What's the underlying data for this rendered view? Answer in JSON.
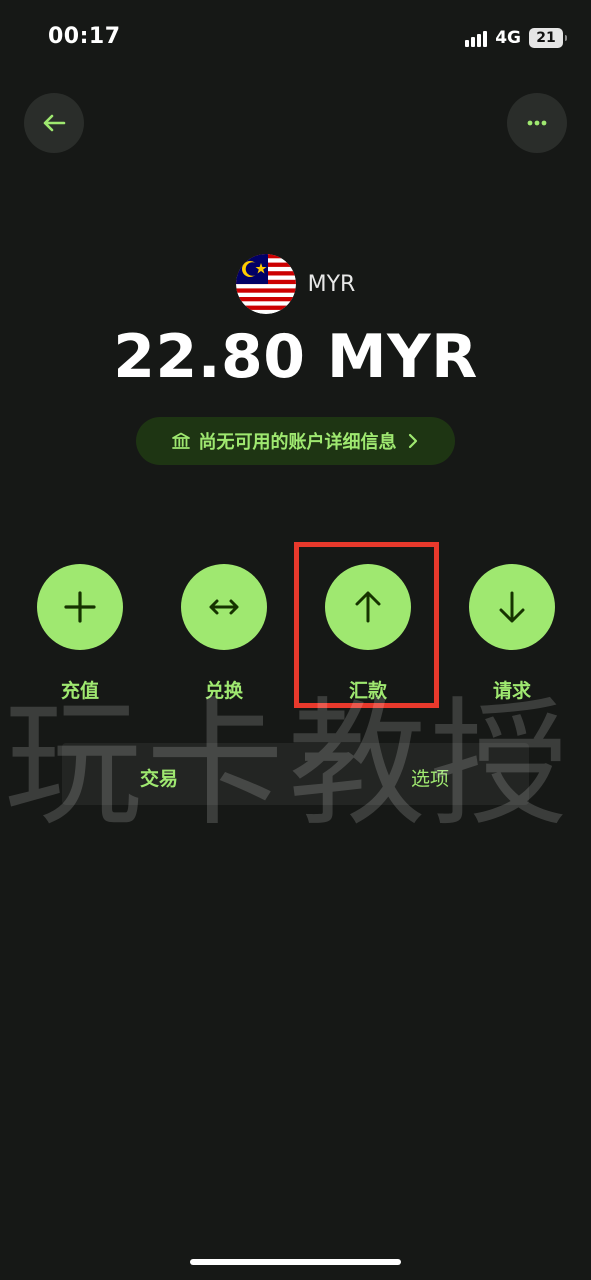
{
  "status_bar": {
    "time": "00:17",
    "network": "4G",
    "battery": "21"
  },
  "header": {
    "back_icon": "arrow-left-icon",
    "more_icon": "ellipsis-icon"
  },
  "account": {
    "currency_code": "MYR",
    "flag_icon": "malaysia-flag-icon",
    "balance": "22.80 MYR",
    "details_text": "尚无可用的账户详细信息"
  },
  "actions": [
    {
      "label": "充值",
      "icon": "plus-icon"
    },
    {
      "label": "兑换",
      "icon": "swap-arrows-icon"
    },
    {
      "label": "汇款",
      "icon": "arrow-up-icon"
    },
    {
      "label": "请求",
      "icon": "arrow-down-icon"
    }
  ],
  "tabs": {
    "transactions": "交易",
    "options": "选项"
  },
  "watermark": "玩卡教授",
  "colors": {
    "background": "#161816",
    "accent": "#9fe870",
    "pill_bg": "#1e3513",
    "highlight": "#e8392c"
  }
}
